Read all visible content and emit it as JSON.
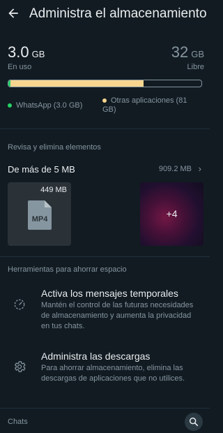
{
  "header": {
    "title": "Administra el almacenamiento",
    "back_icon": "arrow-left-icon"
  },
  "storage": {
    "used_value": "3.0",
    "used_unit": "GB",
    "used_label": "En uso",
    "free_value": "32",
    "free_unit": "GB",
    "free_label": "Libre",
    "whatsapp_fraction": 0.012,
    "other_fraction": 0.69,
    "legend_whatsapp": "WhatsApp (3.0 GB)",
    "legend_other": "Otras aplicaciones (81 GB)",
    "colors": {
      "whatsapp": "#25d366",
      "other": "#f7d58f"
    }
  },
  "review": {
    "heading": "Revisa y elimina elementos",
    "large_files_label": "De más de 5 MB",
    "large_files_size": "909.2 MB",
    "thumbnails": [
      {
        "size": "449 MB",
        "file_type": "MP4"
      },
      {
        "more_count": "+4"
      }
    ]
  },
  "tools": {
    "heading": "Herramientas para ahorrar espacio",
    "items": [
      {
        "icon": "timer-icon",
        "title": "Activa los mensajes temporales",
        "description": "Mantén el control de las futuras necesidades de almacenamiento y aumenta la privacidad en tus chats."
      },
      {
        "icon": "gear-icon",
        "title": "Administra las descargas",
        "description": "Para ahorrar almacenamiento, elimina las descargas de aplicaciones que no utilices."
      }
    ]
  },
  "chats": {
    "heading": "Chats",
    "search_icon": "search-icon"
  }
}
